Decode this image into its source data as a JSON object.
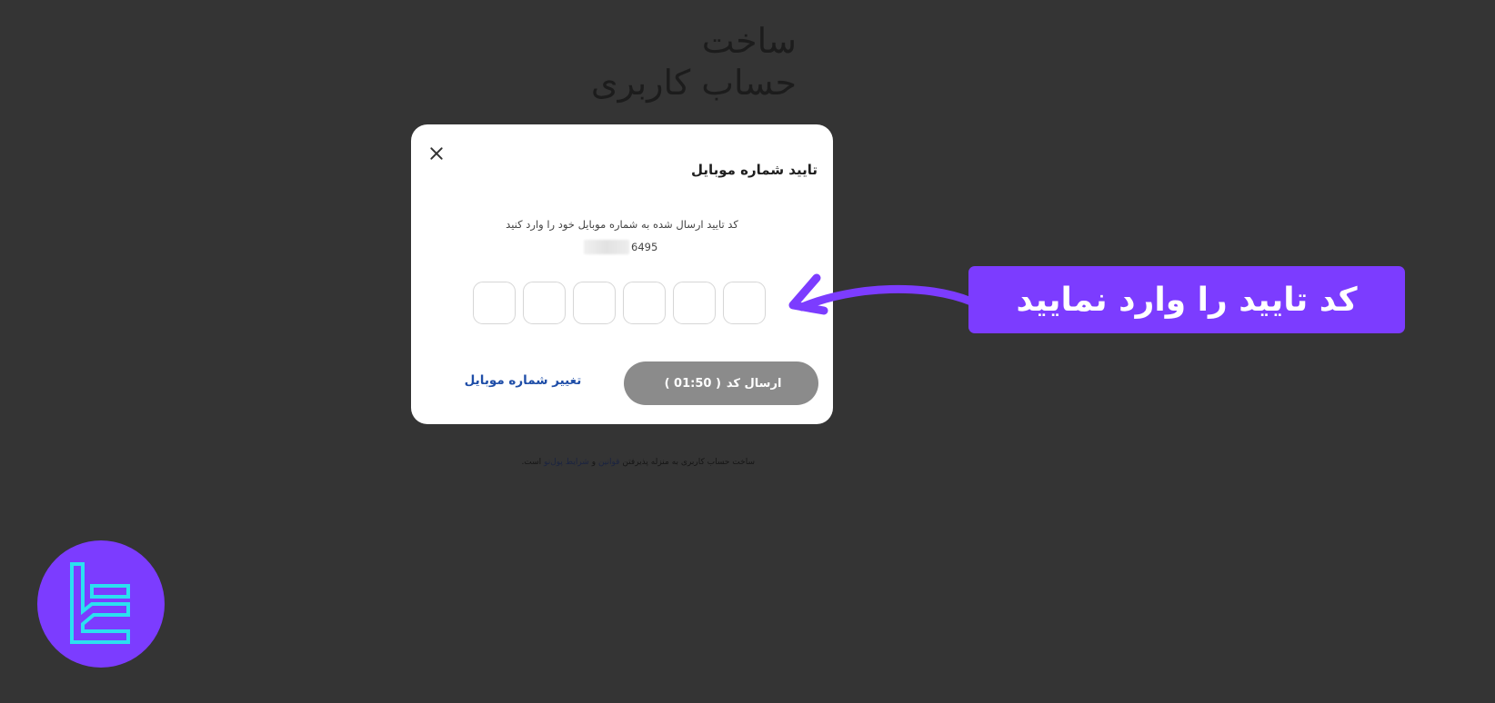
{
  "background": {
    "title_line1": "ساخت",
    "title_line2": "حساب کاربری",
    "terms_part1": "ساخت حساب کاربری به منزله پذیرفتن",
    "terms_link1": "قوانین",
    "terms_and": "و",
    "terms_link2": "شرایط پول‌نو",
    "terms_end": "است."
  },
  "modal": {
    "title": "تایید شماره موبایل",
    "instruction": "کد تایید ارسال شده به شماره موبایل خود را وارد کنید",
    "phone_suffix": "6495",
    "send_label": "ارسال کد",
    "timer": "( 01:50 )",
    "change_link": "تغییر شماره موبایل",
    "code_boxes": [
      "",
      "",
      "",
      "",
      "",
      ""
    ]
  },
  "callout": {
    "text": "کد تایید را وارد نمایید"
  },
  "colors": {
    "page_bg": "#343434",
    "accent_purple": "#7c3cff",
    "button_disabled": "#8b8b8b",
    "link_blue": "#1f4ea8",
    "logo_cyan": "#2be0f0"
  },
  "icons": {
    "close": "close-icon",
    "arrow": "arrow-left-icon",
    "logo": "brand-logo"
  }
}
